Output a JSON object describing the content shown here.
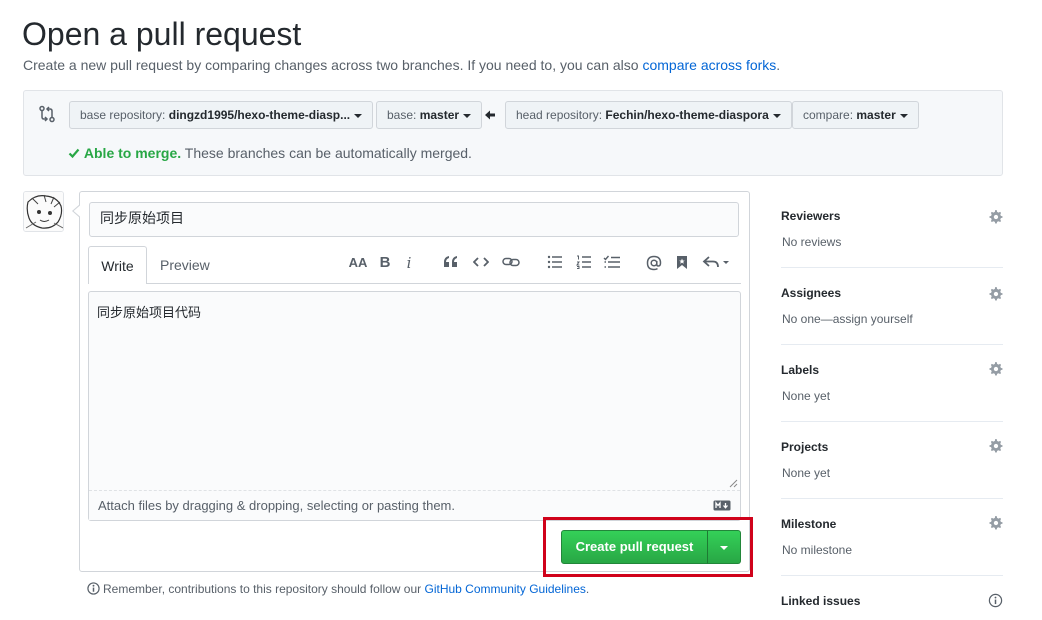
{
  "header": {
    "title": "Open a pull request",
    "subtitle": "Create a new pull request by comparing changes across two branches. If you need to, you can also",
    "compare_forks_link": "compare across forks",
    "subtitle_end": "."
  },
  "range": {
    "base_repo_label": "base repository:",
    "base_repo_value": "dingzd1995/hexo-theme-diasp...",
    "base_label": "base:",
    "base_value": "master",
    "head_repo_label": "head repository:",
    "head_repo_value": "Fechin/hexo-theme-diaspora",
    "compare_label": "compare:",
    "compare_value": "master",
    "merge_status": "Able to merge.",
    "merge_message": "These branches can be automatically merged."
  },
  "form": {
    "title_value": "同步原始项目",
    "tabs": {
      "write": "Write",
      "preview": "Preview"
    },
    "toolbar": {
      "heading": "AA",
      "bold": "B",
      "italic": "i"
    },
    "comment_value": "同步原始项目代码",
    "attach_text": "Attach files by dragging & dropping, selecting or pasting them.",
    "create_button": "Create pull request"
  },
  "guidelines": {
    "text": "Remember, contributions to this repository should follow our",
    "link": "GitHub Community Guidelines",
    "end": "."
  },
  "sidebar": {
    "reviewers": {
      "title": "Reviewers",
      "value": "No reviews"
    },
    "assignees": {
      "title": "Assignees",
      "value": "No one—assign yourself"
    },
    "labels": {
      "title": "Labels",
      "value": "None yet"
    },
    "projects": {
      "title": "Projects",
      "value": "None yet"
    },
    "milestone": {
      "title": "Milestone",
      "value": "No milestone"
    },
    "linked_issues": {
      "title": "Linked issues"
    }
  },
  "icons": {
    "compare": "git-compare-icon",
    "arrow": "arrow-left-icon",
    "check": "check-icon",
    "gear": "gear-icon",
    "info": "info-icon",
    "markdown": "markdown-icon"
  },
  "colors": {
    "accent_link": "#0366d6",
    "success": "#28a745",
    "highlight": "#d0021b"
  }
}
